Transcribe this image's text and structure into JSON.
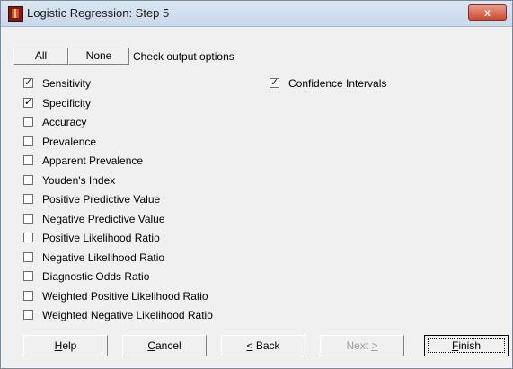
{
  "window": {
    "title": "Logistic Regression: Step 5",
    "close_label": "x"
  },
  "top": {
    "all_label": "All",
    "none_label": "None",
    "check_label": "Check output options"
  },
  "options": [
    {
      "label": "Sensitivity",
      "checked": true
    },
    {
      "label": "Specificity",
      "checked": true
    },
    {
      "label": "Accuracy",
      "checked": false
    },
    {
      "label": "Prevalence",
      "checked": false
    },
    {
      "label": "Apparent Prevalence",
      "checked": false
    },
    {
      "label": "Youden's Index",
      "checked": false
    },
    {
      "label": "Positive Predictive Value",
      "checked": false
    },
    {
      "label": "Negative Predictive Value",
      "checked": false
    },
    {
      "label": "Positive Likelihood Ratio",
      "checked": false
    },
    {
      "label": "Negative Likelihood Ratio",
      "checked": false
    },
    {
      "label": "Diagnostic Odds Ratio",
      "checked": false
    },
    {
      "label": "Weighted Positive Likelihood Ratio",
      "checked": false
    },
    {
      "label": "Weighted Negative Likelihood Ratio",
      "checked": false
    }
  ],
  "confidence": {
    "label": "Confidence Intervals",
    "checked": true
  },
  "buttons": {
    "help": {
      "pre": "",
      "u": "H",
      "post": "elp"
    },
    "cancel": {
      "pre": "",
      "u": "C",
      "post": "ancel"
    },
    "back": {
      "pre": "",
      "u": "<",
      "post": " Back"
    },
    "next": {
      "pre": "Next ",
      "u": ">",
      "post": ""
    },
    "finish": {
      "pre": "",
      "u": "F",
      "post": "inish"
    }
  }
}
